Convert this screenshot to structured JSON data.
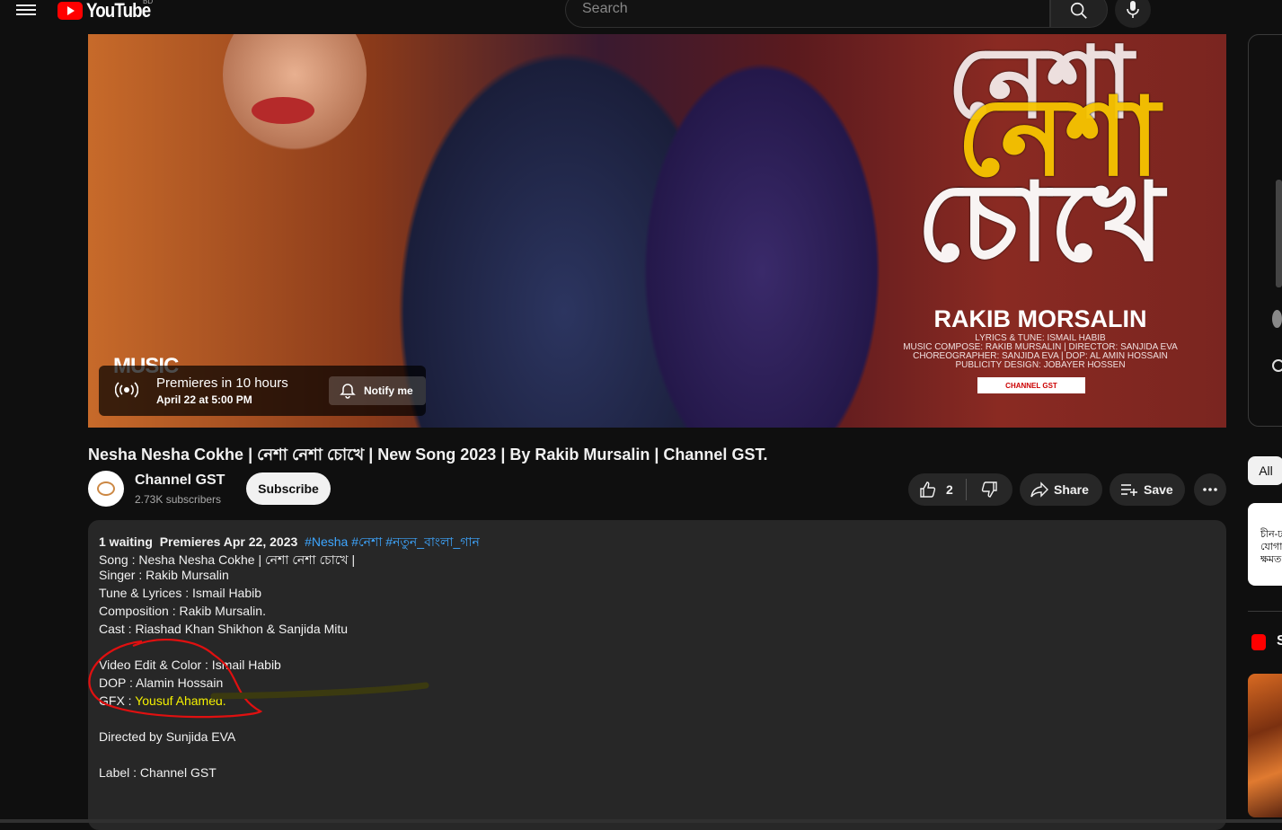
{
  "header": {
    "logo_text": "YouTube",
    "country_code": "BD",
    "search_placeholder": "Search"
  },
  "thumbnail": {
    "title_bn_line1": "নেশা",
    "title_bn_line2": "চোখে",
    "artist": "RAKIB MORSALIN",
    "credits": [
      "LYRICS & TUNE: ISMAIL HABIB",
      "MUSIC COMPOSE: RAKIB MURSALIN | DIRECTOR: SANJIDA EVA",
      "CHOREOGRAPHER: SANJIDA EVA | DOP: AL AMIN HOSSAIN",
      "PUBLICITY DESIGN: JOBAYER HOSSEN"
    ],
    "follow_text": "CHANNEL GST",
    "music_label": "MUSIC"
  },
  "premiere": {
    "title": "Premieres in 10 hours",
    "date": "April 22 at 5:00 PM",
    "notify_label": "Notify me"
  },
  "video": {
    "title": "Nesha Nesha Cokhe | নেশা নেশা চোখে | New Song 2023 | By Rakib Mursalin | Channel GST."
  },
  "channel": {
    "name": "Channel GST",
    "subscribers": "2.73K subscribers",
    "subscribe_label": "Subscribe"
  },
  "actions": {
    "like_count": "2",
    "share_label": "Share",
    "save_label": "Save"
  },
  "description": {
    "waiting": "1 waiting",
    "premieres": "Premieres Apr 22, 2023",
    "hashtags": [
      "#Nesha",
      "#নেশা",
      "#নতুন_বাংলা_গান"
    ],
    "lines": [
      "Song : Nesha Nesha Cokhe | নেশা নেশা চোখে |",
      "Singer : Rakib Mursalin",
      "Tune & Lyrices : Ismail Habib",
      "Composition : Rakib Mursalin.",
      "Cast : Riashad Khan Shikhon & Sanjida Mitu",
      "Video Edit & Color : Ismail Habib",
      "DOP : Alamin Hossain",
      "Directed by Sunjida EVA",
      "Label : Channel GST"
    ],
    "gfx_prefix": "GFX : ",
    "gfx_name": "Yousuf Ahamed."
  },
  "sidebar": {
    "chip_all": "All",
    "card_text": "চীন-ঢ যোগাযে ক্ষমত",
    "shorts_initial": "S"
  },
  "colors": {
    "background": "#0f0f0f",
    "accent_red": "#ff0000",
    "link_blue": "#3ea6ff",
    "highlight_yellow": "#f4f000",
    "annotation_red": "#e01010"
  }
}
